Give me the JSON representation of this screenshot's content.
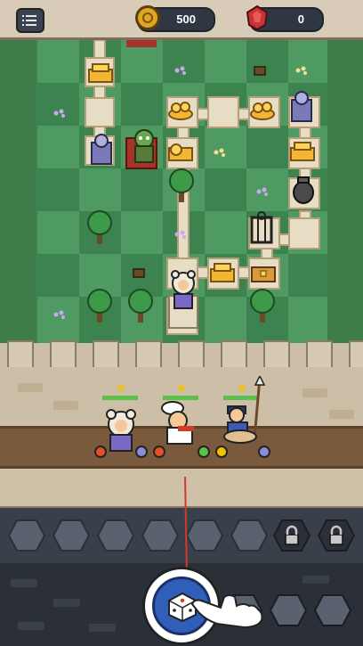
{
  "topbar": {
    "menu_icon": "menu-list-icon",
    "coins": "500",
    "gems": "0",
    "coin_icon": "gold-coin-icon",
    "gem_icon": "red-gem-icon"
  },
  "board": {
    "theme_colors": {
      "grass_light": "#4f9a62",
      "grass_dark": "#3c8350",
      "path": "#e7dcc4"
    },
    "tile_types": [
      "gold-chest",
      "empty-tile",
      "shrine",
      "enemy-goblin",
      "cage",
      "urn",
      "treasure-chest"
    ]
  },
  "heroes": [
    {
      "name": "bear-hood-hero",
      "stars": "★",
      "hp": 1.0
    },
    {
      "name": "chef-hero",
      "stars": "★",
      "hp": 1.0
    },
    {
      "name": "spear-rider-hero",
      "stars": "★",
      "hp": 1.0
    }
  ],
  "slots": {
    "open_count": 6,
    "locked_count": 2,
    "lock_icon": "padlock-icon"
  },
  "dice": {
    "icon": "dice-icon",
    "hand_icon": "pointing-hand-icon"
  },
  "colors": {
    "accent_blue": "#2f5fb8",
    "hp_green": "#5bc148",
    "star_yellow": "#f3c000"
  }
}
